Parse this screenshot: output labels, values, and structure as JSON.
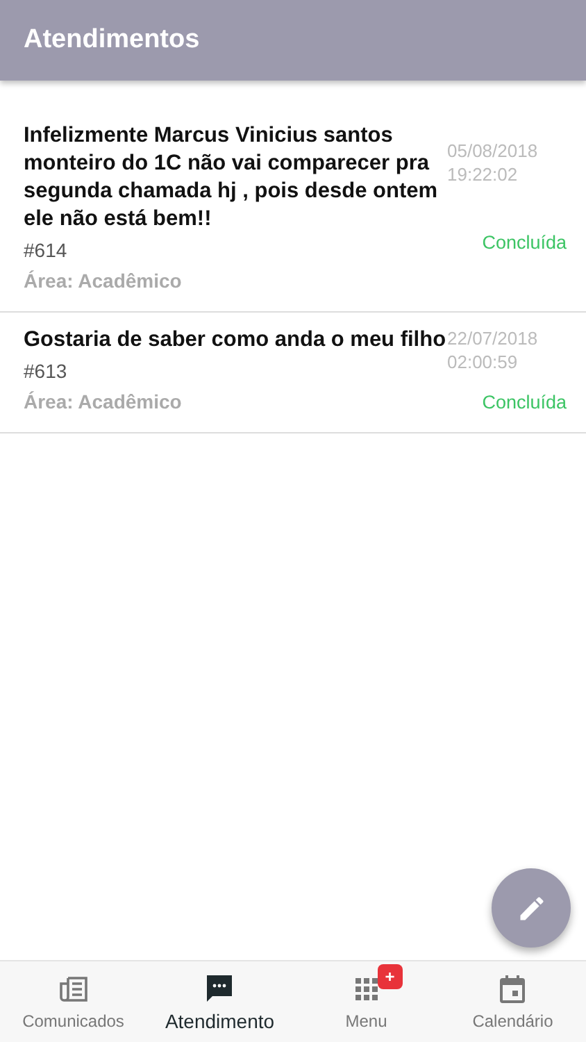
{
  "header": {
    "title": "Atendimentos"
  },
  "tickets": [
    {
      "message": "Infelizmente Marcus Vinicius santos monteiro do 1C não vai comparecer pra segunda chamada hj , pois desde ontem ele não está bem!!",
      "number": "#614",
      "area": "Área: Acadêmico",
      "date": "05/08/2018",
      "time": "19:22:02",
      "status": "Concluída"
    },
    {
      "message": "Gostaria de saber como anda o meu filho",
      "number": "#613",
      "area": "Área: Acadêmico",
      "date": "22/07/2018",
      "time": "02:00:59",
      "status": "Concluída"
    }
  ],
  "nav": [
    {
      "kind": "news",
      "label": "Comunicados",
      "selected": false
    },
    {
      "kind": "chat",
      "label": "Atendimento",
      "selected": true
    },
    {
      "kind": "grid",
      "label": "Menu",
      "selected": false,
      "badge": "+"
    },
    {
      "kind": "calendar",
      "label": "Calendário",
      "selected": false
    }
  ]
}
